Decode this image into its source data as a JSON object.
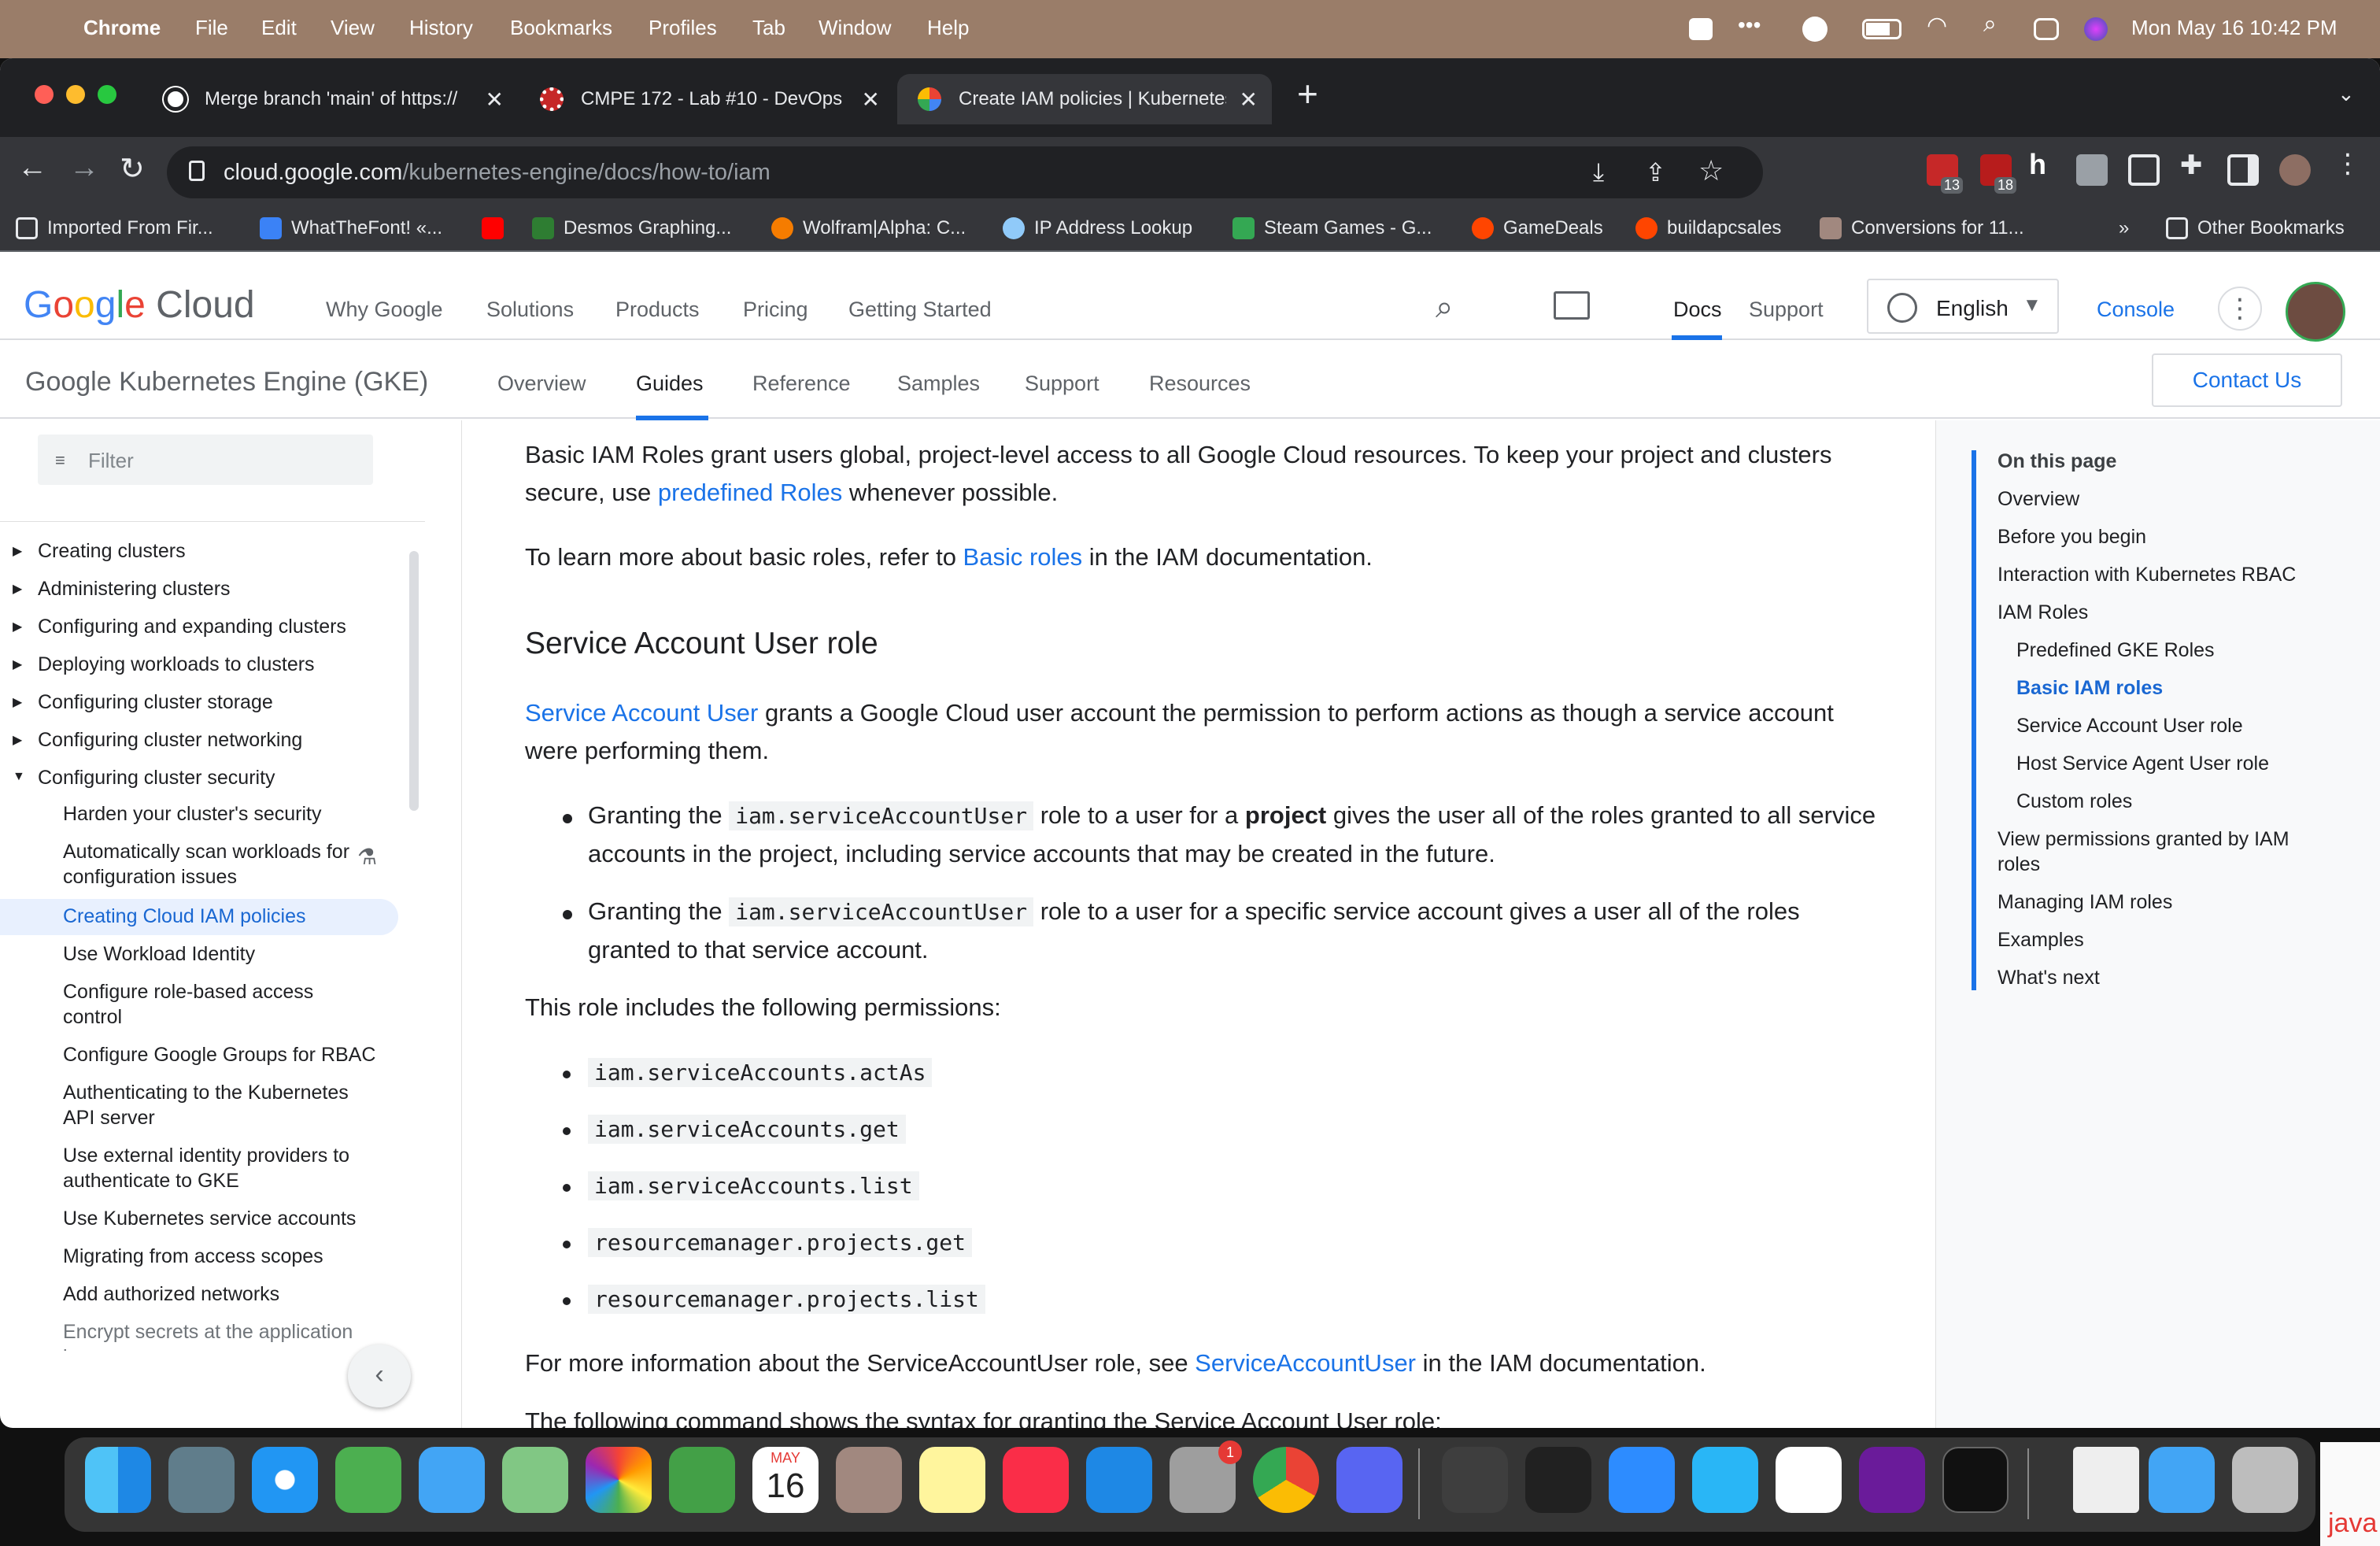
{
  "menubar": {
    "app": "Chrome",
    "items": [
      "File",
      "Edit",
      "View",
      "History",
      "Bookmarks",
      "Profiles",
      "Tab",
      "Window",
      "Help"
    ],
    "datetime": "Mon May 16  10:42 PM"
  },
  "tabs": [
    {
      "title": "Merge branch 'main' of https://",
      "icon": "github-icon"
    },
    {
      "title": "CMPE 172 - Lab #10 - DevOps",
      "icon": "circleci-icon"
    },
    {
      "title": "Create IAM policies | Kubernetes",
      "icon": "google-cloud-icon"
    }
  ],
  "new_tab": "+",
  "url": {
    "host": "cloud.google.com",
    "path": "/kubernetes-engine/docs/how-to/iam"
  },
  "extensions": {
    "badge1": "13",
    "badge2": "18"
  },
  "bookmarks": [
    "Imported From Fir...",
    "WhatTheFont! «...",
    "Desmos Graphing...",
    "Wolfram|Alpha: C...",
    "IP Address Lookup",
    "Steam Games - G...",
    "GameDeals",
    "buildapcsales",
    "Conversions for 11..."
  ],
  "bookmarks_more": "»",
  "other_bookmarks": "Other Bookmarks",
  "gcloud": {
    "logo": "Google Cloud",
    "nav": [
      "Why Google",
      "Solutions",
      "Products",
      "Pricing",
      "Getting Started"
    ],
    "docs": "Docs",
    "support": "Support",
    "language": "English",
    "console": "Console"
  },
  "product": {
    "name": "Google Kubernetes Engine (GKE)",
    "tabs": [
      "Overview",
      "Guides",
      "Reference",
      "Samples",
      "Support",
      "Resources"
    ],
    "contact": "Contact Us"
  },
  "sidebar": {
    "filter_placeholder": "Filter",
    "sections": [
      "Creating clusters",
      "Administering clusters",
      "Configuring and expanding clusters",
      "Deploying workloads to clusters",
      "Configuring cluster storage",
      "Configuring cluster networking",
      "Configuring cluster security"
    ],
    "items": [
      "Harden your cluster's security",
      "Automatically scan workloads for configuration issues",
      "Creating Cloud IAM policies",
      "Use Workload Identity",
      "Configure role-based access control",
      "Configure Google Groups for RBAC",
      "Authenticating to the Kubernetes API server",
      "Use external identity providers to authenticate to GKE",
      "Use Kubernetes service accounts",
      "Migrating from access scopes",
      "Add authorized networks",
      "Encrypt secrets at the application layer"
    ]
  },
  "content": {
    "p1a": "Basic IAM Roles grant users global, project-level access to all Google Cloud resources. To keep your project and clusters secure, use ",
    "p1link": "predefined Roles",
    "p1b": " whenever possible.",
    "p2a": "To learn more about basic roles, refer to ",
    "p2link": "Basic roles",
    "p2b": " in the IAM documentation.",
    "h2": "Service Account User role",
    "p3link": "Service Account User",
    "p3b": " grants a Google Cloud user account the permission to perform actions as though a service account were performing them.",
    "li1a": "Granting the ",
    "li1code": "iam.serviceAccountUser",
    "li1b": " role to a user for a ",
    "li1bold": "project",
    "li1c": " gives the user all of the roles granted to all service accounts in the project, including service accounts that may be created in the future.",
    "li2a": "Granting the ",
    "li2code": "iam.serviceAccountUser",
    "li2b": " role to a user for a specific service account gives a user all of the roles granted to that service account.",
    "p4": "This role includes the following permissions:",
    "perms": [
      "iam.serviceAccounts.actAs",
      "iam.serviceAccounts.get",
      "iam.serviceAccounts.list",
      "resourcemanager.projects.get",
      "resourcemanager.projects.list"
    ],
    "p5a": "For more information about the ServiceAccountUser role, see ",
    "p5link": "ServiceAccountUser",
    "p5b": " in the IAM documentation.",
    "p6": "The following command shows the syntax for granting the Service Account User role:"
  },
  "toc": {
    "title": "On this page",
    "items": [
      "Overview",
      "Before you begin",
      "Interaction with Kubernetes RBAC",
      "IAM Roles",
      "Predefined GKE Roles",
      "Basic IAM roles",
      "Service Account User role",
      "Host Service Agent User role",
      "Custom roles",
      "View permissions granted by IAM roles",
      "Managing IAM roles",
      "Examples",
      "What's next"
    ]
  },
  "dock": {
    "calendar_month": "MAY",
    "calendar_day": "16",
    "settings_badge": "1",
    "java_label": "java"
  }
}
